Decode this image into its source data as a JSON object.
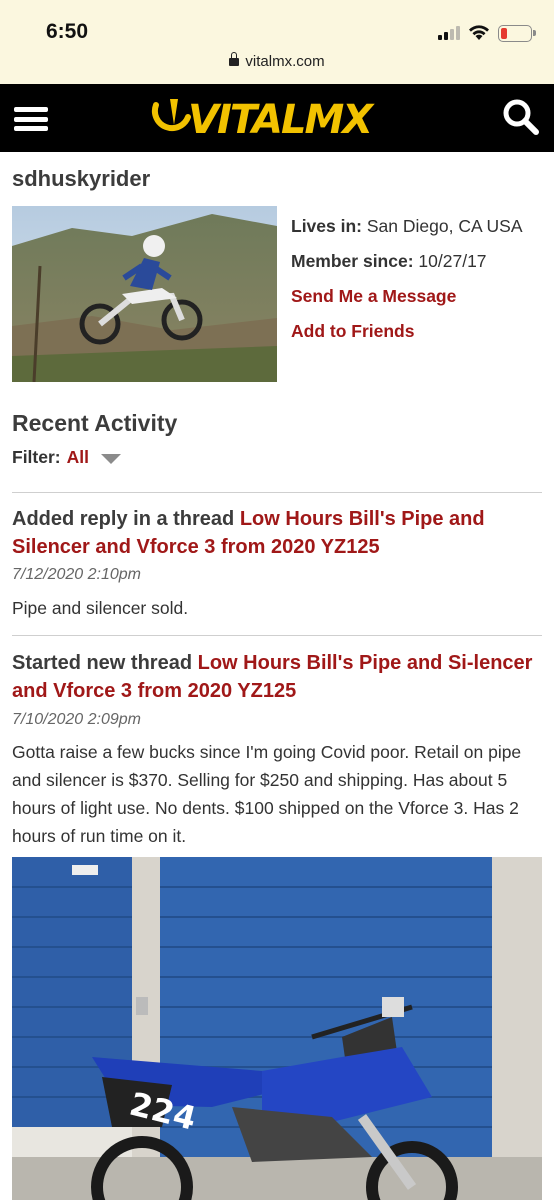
{
  "status_bar": {
    "time": "6:50",
    "url": "vitalmx.com",
    "battery_color": "#e53a2f"
  },
  "header": {
    "logo_text": "VITALMX",
    "logo_color": "#f2c200",
    "menu_icon": "hamburger-menu-icon",
    "search_icon": "search-icon"
  },
  "profile": {
    "username": "sdhuskyrider",
    "lives_in_label": "Lives in:",
    "lives_in_value": "San Diego, CA USA",
    "member_since_label": "Member since:",
    "member_since_value": "10/27/17",
    "send_message": "Send Me a Message",
    "add_friends": "Add to Friends"
  },
  "activity": {
    "title": "Recent Activity",
    "filter_label": "Filter:",
    "filter_value": "All",
    "items": [
      {
        "action": "Added reply in a thread",
        "thread_title": "Low Hours Bill's Pipe and Silencer and Vforce 3 from 2020 YZ125",
        "date": "7/12/2020 2:10pm",
        "body": "Pipe and silencer sold."
      },
      {
        "action": "Started new thread",
        "thread_title": "Low Hours Bill's Pipe and Si-lencer and Vforce 3 from 2020 YZ125",
        "date": "7/10/2020 2:09pm",
        "body": "Gotta raise a few bucks since I'm going Covid poor. Retail on pipe and silencer is $370. Selling for $250 and shipping. Has about 5 hours of light use. No dents. $100 shipped on the Vforce 3. Has 2 hours of run time on it.",
        "photo_number": "224"
      }
    ]
  },
  "colors": {
    "link": "#a01818",
    "header_bg": "#000000",
    "status_bg": "#fbf7df"
  }
}
